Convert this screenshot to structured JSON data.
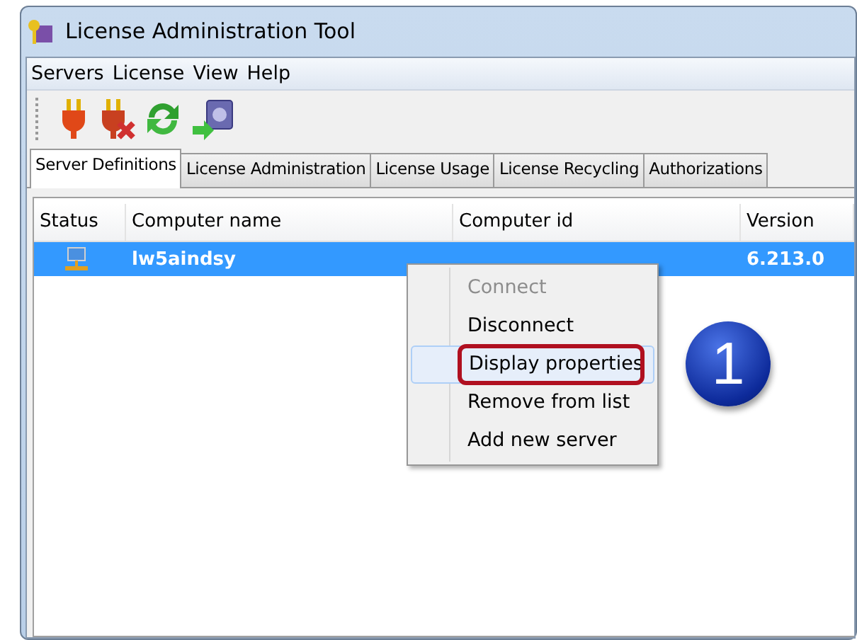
{
  "window": {
    "title": "License Administration Tool"
  },
  "menu_bar": [
    "Servers",
    "License",
    "View",
    "Help"
  ],
  "tabs": [
    {
      "label": "Server Definitions",
      "selected": true
    },
    {
      "label": "License Administration",
      "selected": false
    },
    {
      "label": "License Usage",
      "selected": false
    },
    {
      "label": "License Recycling",
      "selected": false
    },
    {
      "label": "Authorizations",
      "selected": false
    }
  ],
  "table": {
    "columns": [
      "Status",
      "Computer name",
      "Computer id",
      "Version"
    ],
    "rows": [
      {
        "computer_name": "lw5aindsy",
        "version": "6.213.0",
        "selected": true
      }
    ]
  },
  "context_menu": [
    {
      "label": "Connect",
      "disabled": true,
      "highlighted": false
    },
    {
      "label": "Disconnect",
      "disabled": false,
      "highlighted": false
    },
    {
      "label": "Display properties",
      "disabled": false,
      "highlighted": true
    },
    {
      "label": "Remove from list",
      "disabled": false,
      "highlighted": false
    },
    {
      "label": "Add new server",
      "disabled": false,
      "highlighted": false
    }
  ],
  "step_badge": "1"
}
